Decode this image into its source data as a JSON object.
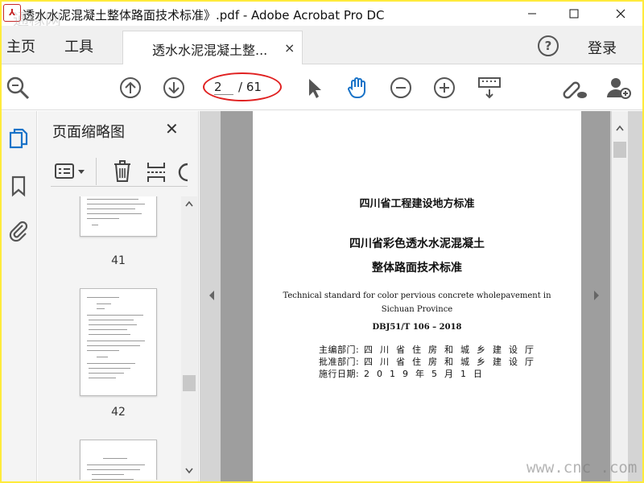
{
  "window": {
    "title": "透水水泥混凝土整体路面技术标准》.pdf - Adobe Acrobat Pro DC",
    "app_icon": "acrobat-icon"
  },
  "menubar": {
    "home": "主页",
    "tools": "工具",
    "tab_label": "透水水泥混凝土整...",
    "tab_close": "×",
    "help": "?",
    "login": "登录"
  },
  "toolbar": {
    "current_page": "2",
    "total_pages": "/ 61",
    "icons": [
      "zoom-search-icon",
      "prev-page-icon",
      "next-page-icon",
      "select-arrow-icon",
      "hand-tool-icon",
      "zoom-out-icon",
      "zoom-in-icon",
      "keyboard-icon",
      "link-cloud-icon",
      "add-user-icon"
    ]
  },
  "sidebar": {
    "title": "页面缩略图",
    "close": "✕",
    "thumbnails": [
      {
        "label": "41"
      },
      {
        "label": "42"
      }
    ]
  },
  "document": {
    "line1": "四川省工程建设地方标准",
    "line2": "四川省彩色透水水泥混凝土",
    "line3": "整体路面技术标准",
    "english1": "Technical standard for color pervious concrete wholepavement in",
    "english2": "Sichuan Province",
    "code": "DBJ51/T 106 – 2018",
    "meta": [
      {
        "label": "主编部门:",
        "value": "四川省住房和城乡建设厅"
      },
      {
        "label": "批准部门:",
        "value": "四川省住房和城乡建设厅"
      },
      {
        "label": "施行日期:",
        "value": "2019年5月1日"
      }
    ]
  },
  "watermarks": {
    "top_left": "通稼网",
    "bottom_right": "www.cnc  .com"
  },
  "colors": {
    "frame": "#ffeb3b",
    "annotation": "#e02020",
    "accent_blue": "#1a73c8"
  }
}
